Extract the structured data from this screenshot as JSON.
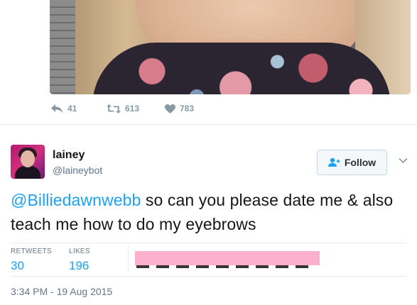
{
  "previous_tweet": {
    "photo_alt": "",
    "actions": {
      "reply_count": "41",
      "retweet_count": "613",
      "like_count": "783"
    }
  },
  "tweet": {
    "user": {
      "name": "lainey",
      "handle": "@laineybot"
    },
    "follow_label": "Follow",
    "text": {
      "mention": "@Billiedawnwebb",
      "body": " so can you please date me & also teach me how to do my eyebrows"
    },
    "stats": {
      "retweets_label": "RETWEETS",
      "retweets_value": "30",
      "likes_label": "LIKES",
      "likes_value": "196"
    },
    "timestamp": "3:34 PM - 19 Aug 2015"
  },
  "colors": {
    "accent": "#1da1f2",
    "muted": "#657786",
    "icon": "#8899a6",
    "redaction": "#fdb0cc"
  },
  "icons": {
    "reply": "reply-icon",
    "retweet": "retweet-icon",
    "like": "heart-icon",
    "follow": "add-user-icon",
    "more": "chevron-down-icon"
  }
}
